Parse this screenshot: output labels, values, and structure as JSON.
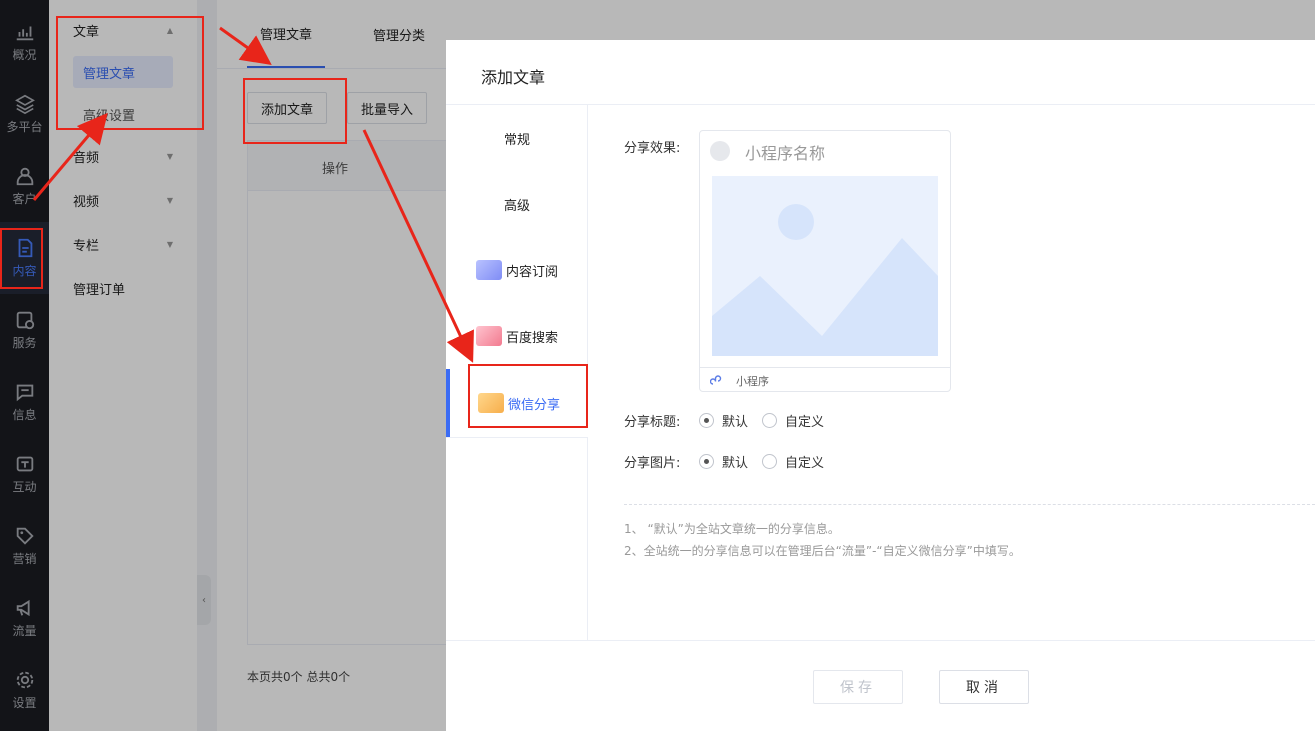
{
  "rail": {
    "items": [
      {
        "label": "概况",
        "icon": "chart-icon"
      },
      {
        "label": "多平台",
        "icon": "layers-icon"
      },
      {
        "label": "客户",
        "icon": "user-icon"
      },
      {
        "label": "内容",
        "icon": "document-icon",
        "active": true
      },
      {
        "label": "服务",
        "icon": "service-icon"
      },
      {
        "label": "信息",
        "icon": "message-icon"
      },
      {
        "label": "互动",
        "icon": "interact-icon"
      },
      {
        "label": "营销",
        "icon": "tag-icon"
      },
      {
        "label": "流量",
        "icon": "megaphone-icon"
      },
      {
        "label": "设置",
        "icon": "gear-icon"
      }
    ]
  },
  "submenu": {
    "article": "文章",
    "manage_article": "管理文章",
    "advanced": "高级设置",
    "audio": "音频",
    "video": "视频",
    "column": "专栏",
    "orders": "管理订单"
  },
  "main": {
    "tab_manage": "管理文章",
    "tab_category": "管理分类",
    "add_article": "添加文章",
    "batch_import": "批量导入",
    "col_action": "操作",
    "pager": "本页共0个  总共0个"
  },
  "drawer": {
    "title": "添加文章",
    "nav": {
      "general": "常规",
      "advanced": "高级",
      "subscribe": "内容订阅",
      "baidu": "百度搜索",
      "wechat": "微信分享"
    },
    "share_effect_label": "分享效果:",
    "preview_name": "小程序名称",
    "preview_footer": "小程序",
    "share_title_label": "分享标题:",
    "share_image_label": "分享图片:",
    "opt_default": "默认",
    "opt_custom": "自定义",
    "note1": "1、 “默认”为全站文章统一的分享信息。",
    "note2": "2、全站统一的分享信息可以在管理后台“流量”-“自定义微信分享”中填写。",
    "save": "保存",
    "cancel": "取消"
  },
  "colors": {
    "accent": "#3b6cf4",
    "annotation": "#e8251a",
    "rail_bg": "#1b1d22"
  }
}
